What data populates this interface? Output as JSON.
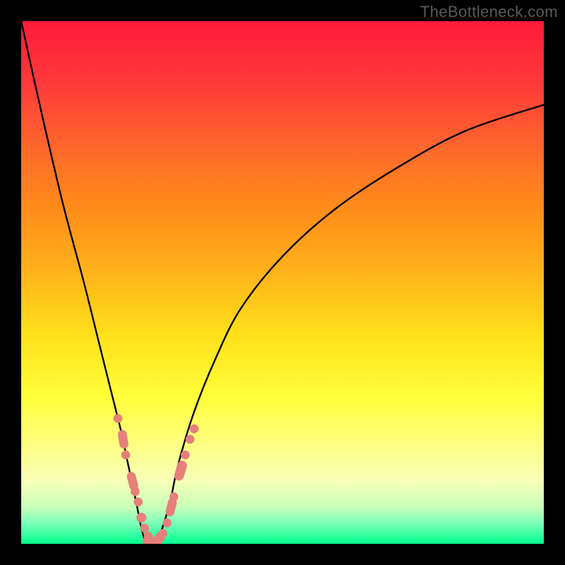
{
  "watermark": "TheBottleneck.com",
  "colors": {
    "frame": "#000000",
    "gradient_top": "#ff1a3a",
    "gradient_bottom": "#00ff90",
    "curve": "#000000",
    "marker": "#e77f7a",
    "watermark": "#5a5a5a"
  },
  "chart_data": {
    "type": "line",
    "title": "",
    "xlabel": "",
    "ylabel": "",
    "xlim": [
      0,
      100
    ],
    "ylim": [
      0,
      100
    ],
    "annotations": [
      "TheBottleneck.com"
    ],
    "series": [
      {
        "name": "bottleneck-curve",
        "x": [
          0,
          4,
          8,
          12,
          15,
          17,
          19,
          20.5,
          22,
          23,
          24,
          25,
          26,
          27,
          28.5,
          30,
          33,
          37,
          42,
          50,
          60,
          72,
          85,
          100
        ],
        "y": [
          100,
          82,
          65,
          50,
          38,
          30,
          22,
          15,
          8,
          3,
          0,
          0,
          0,
          3,
          8,
          15,
          25,
          35,
          45,
          55,
          64,
          72,
          79,
          84
        ]
      }
    ],
    "markers": {
      "name": "data-points",
      "x": [
        18.5,
        19.5,
        20.0,
        21.3,
        21.8,
        22.4,
        23.0,
        23.6,
        24.3,
        25.0,
        26.0,
        27.1,
        27.9,
        28.7,
        29.2,
        30.5,
        31.4,
        32.3,
        33.1
      ],
      "y": [
        24,
        20,
        17,
        12,
        10,
        8,
        5,
        3,
        1.5,
        0.5,
        0.5,
        2,
        4,
        7,
        9,
        14,
        17,
        20,
        22
      ],
      "size": [
        9,
        12,
        9,
        12,
        9,
        9,
        10,
        9,
        9,
        12,
        13,
        9,
        9,
        12,
        9,
        13,
        9,
        9,
        9
      ]
    }
  }
}
